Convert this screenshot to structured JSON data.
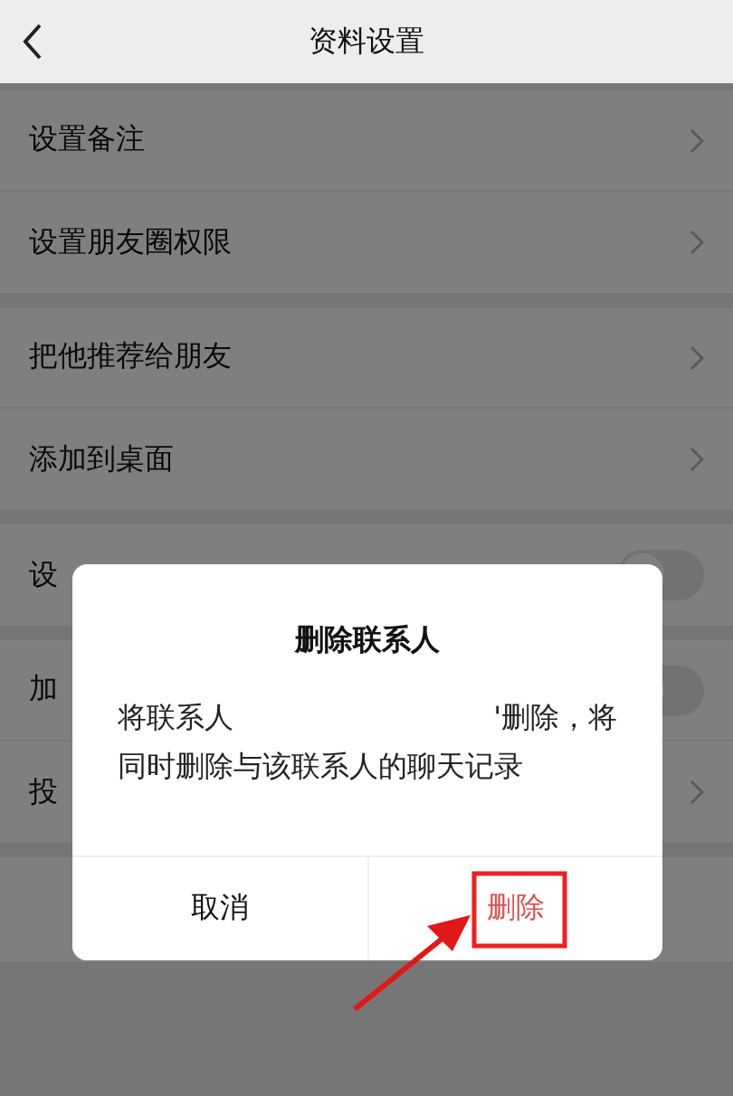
{
  "header": {
    "title": "资料设置"
  },
  "groups": [
    {
      "rows": [
        {
          "label": "设置备注",
          "kind": "link"
        },
        {
          "label": "设置朋友圈权限",
          "kind": "link"
        }
      ]
    },
    {
      "rows": [
        {
          "label": "把他推荐给朋友",
          "kind": "link"
        },
        {
          "label": "添加到桌面",
          "kind": "link"
        }
      ]
    },
    {
      "rows": [
        {
          "label": "设",
          "kind": "toggle",
          "on": false
        }
      ]
    },
    {
      "rows": [
        {
          "label": "加",
          "kind": "toggle",
          "on": false
        },
        {
          "label": "投",
          "kind": "link"
        }
      ]
    },
    {
      "rows": [
        {
          "kind": "action"
        }
      ]
    }
  ],
  "dialog": {
    "title": "删除联系人",
    "message_line_1_start": "将联系人",
    "message_line_1_end": "'删除，将",
    "message_line_2": "同时删除与该联系人的聊天记录",
    "buttons": [
      {
        "label": "取消",
        "kind": "cancel"
      },
      {
        "label": "删除",
        "kind": "destructive"
      }
    ]
  }
}
